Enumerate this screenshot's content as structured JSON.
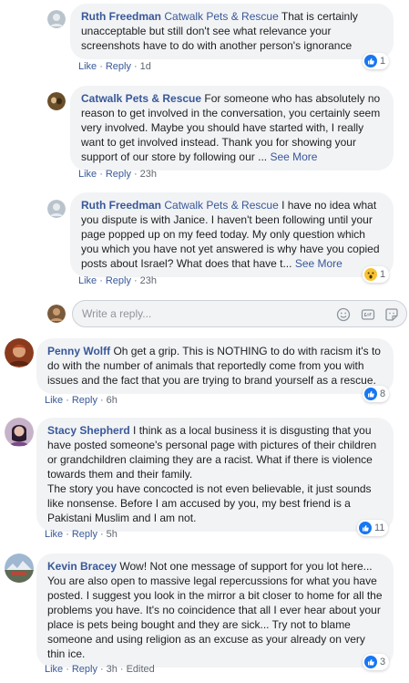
{
  "comments": [
    {
      "author": "Ruth Freedman",
      "mention": "Catwalk Pets & Rescue",
      "text_after_mention": " That is certainly unacceptable but still don't see what relevance your screenshots have to do with another person's ignorance",
      "like": "Like",
      "reply": "Reply",
      "time": "1d",
      "reaction_count": "1",
      "reaction": "like"
    },
    {
      "author": "Catwalk Pets & Rescue",
      "text": " For someone who has absolutely no reason to get involved in the conversation, you certainly seem very involved. Maybe you should have started with, I really want to get involved instead. Thank you for showing your support of our store by following our ... ",
      "see_more": "See More",
      "like": "Like",
      "reply": "Reply",
      "time": "23h"
    },
    {
      "author": "Ruth Freedman",
      "mention": "Catwalk Pets & Rescue",
      "text_after_mention": " I have no idea what you dispute is with Janice. I haven't been following until your page popped up on my feed today. My only question which you which you have not yet answered is why have you copied posts about Israel? What does that have t... ",
      "see_more": "See More",
      "like": "Like",
      "reply": "Reply",
      "time": "23h",
      "reaction_count": "1",
      "reaction": "wow"
    },
    {
      "author": "Penny Wolff",
      "text": " Oh get a grip. This is NOTHING to do with racism it's to do with the number of animals that reportedly come from you with issues and the fact that you are trying to brand yourself as a rescue.",
      "like": "Like",
      "reply": "Reply",
      "time": "6h",
      "reaction_count": "8",
      "reaction": "like"
    },
    {
      "author": "Stacy Shepherd",
      "text": " I think as a local business it is disgusting that you have posted someone's personal page with pictures of their children or grandchildren claiming they are a racist. What if there is violence towards them and their family.",
      "text2": "The story you have concocted is not even believable, it just sounds like nonsense. Before I am accused by you, my best friend is a Pakistani Muslim and I am not.",
      "like": "Like",
      "reply": "Reply",
      "time": "5h",
      "reaction_count": "11",
      "reaction": "like"
    },
    {
      "author": "Kevin Bracey",
      "text": " Wow! Not one message of support for you lot here... You are also open to massive legal repercussions for what you have posted. I suggest you look in the mirror a bit closer to home for all the problems you have. It's no coincidence that all I ever hear about your place is pets being bought and they are sick... Try not to blame someone and using religion as an excuse as your already on very thin ice.",
      "like": "Like",
      "reply": "Reply",
      "time": "3h",
      "edited": "Edited",
      "reaction_count": "3",
      "reaction": "like"
    }
  ],
  "reply_box": {
    "placeholder": "Write a reply..."
  },
  "colors": {
    "link": "#385898",
    "bubble": "#f2f3f5",
    "like_blue": "#1877f2"
  }
}
